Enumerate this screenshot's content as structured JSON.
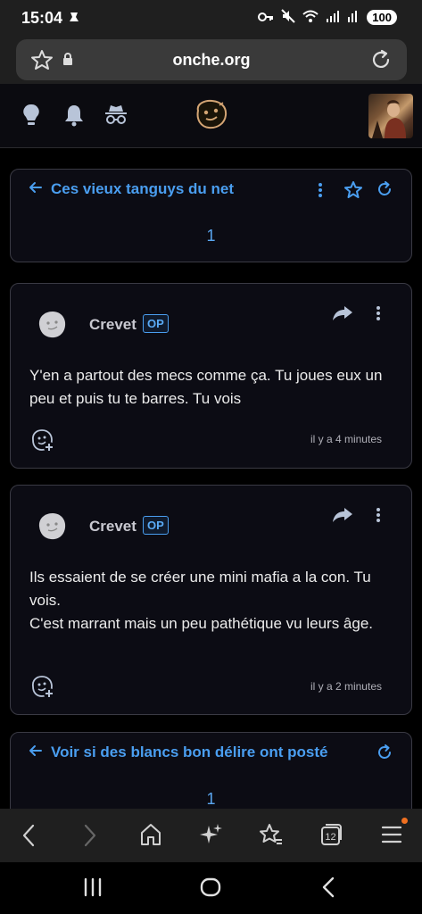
{
  "status_bar": {
    "time": "15:04",
    "battery": "100"
  },
  "browser": {
    "url": "onche.org",
    "tab_count": "12"
  },
  "topic_cards": [
    {
      "title": "Ces vieux tanguys du net",
      "page": "1"
    },
    {
      "title": "Voir si des blancs bon délire ont posté",
      "page": "1"
    }
  ],
  "posts": [
    {
      "author": "Crevet",
      "badge": "OP",
      "lines": [
        "Y'en a partout des mecs comme ça. Tu joues eux un peu et puis tu te barres. Tu vois"
      ],
      "time": "il y a 4 minutes"
    },
    {
      "author": "Crevet",
      "badge": "OP",
      "lines": [
        "Ils essaient de se créer une mini mafia a la con. Tu vois.",
        "C'est marrant mais un peu pathétique vu leurs âge."
      ],
      "time": "il y a 2 minutes"
    }
  ]
}
